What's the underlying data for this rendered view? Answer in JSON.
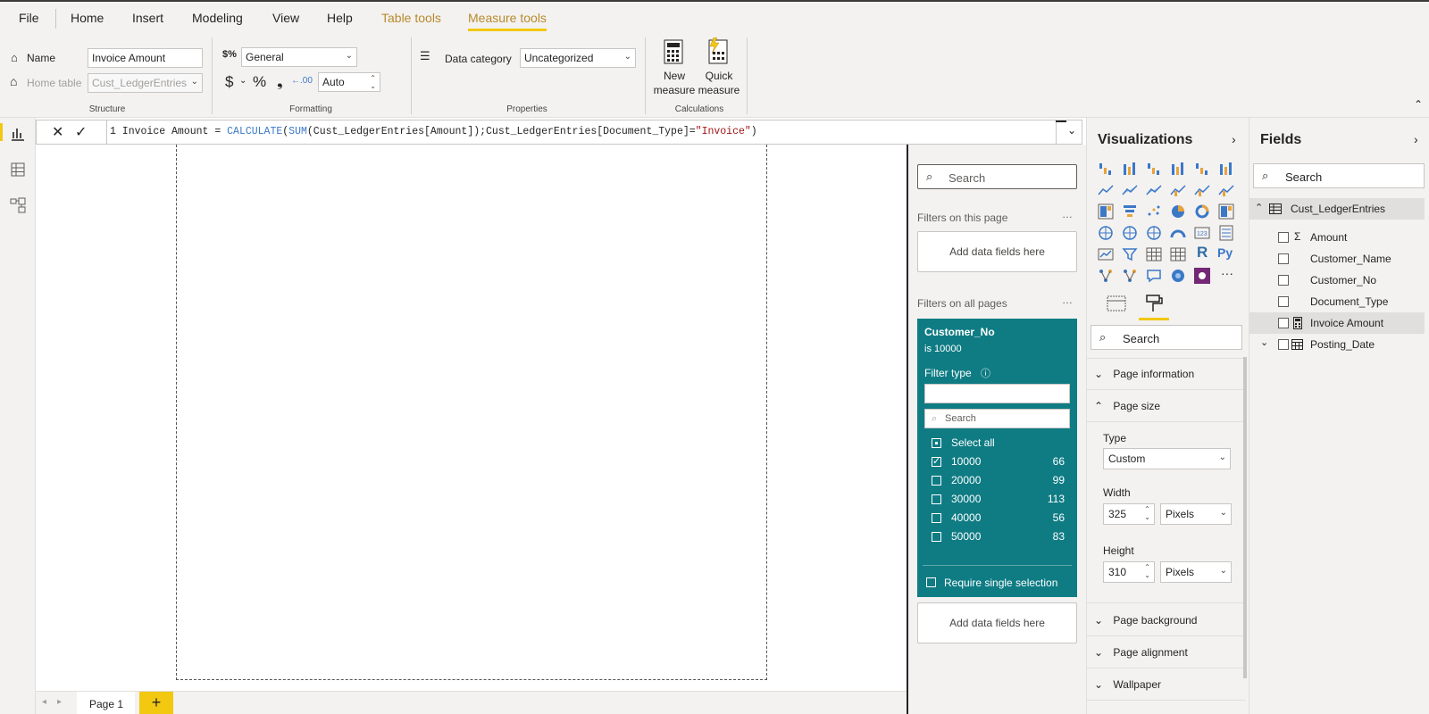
{
  "menu": {
    "file": "File",
    "home": "Home",
    "insert": "Insert",
    "modeling": "Modeling",
    "view": "View",
    "help": "Help",
    "table_tools": "Table tools",
    "measure_tools": "Measure tools"
  },
  "ribbon": {
    "structure": {
      "name_label": "Name",
      "name_value": "Invoice Amount",
      "home_table_label": "Home table",
      "home_table_value": "Cust_LedgerEntries",
      "group_label": "Structure"
    },
    "formatting": {
      "format_value": "General",
      "currency_symbol": "$",
      "percent_symbol": "%",
      "comma_symbol": "❟",
      "decimals_value": "Auto",
      "group_label": "Formatting"
    },
    "properties": {
      "data_category_label": "Data category",
      "data_category_value": "Uncategorized",
      "group_label": "Properties"
    },
    "calculations": {
      "new_measure_line1": "New",
      "new_measure_line2": "measure",
      "quick_measure_line1": "Quick",
      "quick_measure_line2": "measure",
      "group_label": "Calculations"
    }
  },
  "formula": {
    "line_no": "1",
    "part1": " Invoice Amount = ",
    "fn_calculate": "CALCULATE",
    "part2": "(",
    "fn_sum": "SUM",
    "part3": "(Cust_LedgerEntries[Amount]);Cust_LedgerEntries[Document_Type]=",
    "string": "\"Invoice\"",
    "part4": ")"
  },
  "pagetabs": {
    "page1": "Page 1",
    "add": "+"
  },
  "filters": {
    "search_placeholder": "Search",
    "on_this_page": "Filters on this page",
    "add_fields": "Add data fields here",
    "on_all_pages": "Filters on all pages",
    "more": "…",
    "card": {
      "field": "Customer_No",
      "condition": "is 10000",
      "filter_type_label": "Filter type",
      "search_placeholder": "Search",
      "select_all": "Select all",
      "items": [
        {
          "label": "10000",
          "count": "66",
          "checked": true
        },
        {
          "label": "20000",
          "count": "99",
          "checked": false
        },
        {
          "label": "30000",
          "count": "113",
          "checked": false
        },
        {
          "label": "40000",
          "count": "56",
          "checked": false
        },
        {
          "label": "50000",
          "count": "83",
          "checked": false
        }
      ],
      "require_single": "Require single selection"
    },
    "add_fields_bottom": "Add data fields here"
  },
  "visualizations": {
    "title": "Visualizations",
    "search_placeholder": "Search",
    "sections": {
      "page_information": "Page information",
      "page_size": "Page size",
      "type_label": "Type",
      "type_value": "Custom",
      "width_label": "Width",
      "width_value": "325",
      "width_unit": "Pixels",
      "height_label": "Height",
      "height_value": "310",
      "height_unit": "Pixels",
      "page_background": "Page background",
      "page_alignment": "Page alignment",
      "wallpaper": "Wallpaper"
    },
    "r_icon": "R",
    "py_icon": "Py",
    "more_icon": "···"
  },
  "fields": {
    "title": "Fields",
    "search_placeholder": "Search",
    "table_name": "Cust_LedgerEntries",
    "items": [
      {
        "label": "Amount",
        "icon": "sigma-icon",
        "selected": false
      },
      {
        "label": "Customer_Name",
        "icon": "",
        "selected": false
      },
      {
        "label": "Customer_No",
        "icon": "",
        "selected": false
      },
      {
        "label": "Document_Type",
        "icon": "",
        "selected": false
      },
      {
        "label": "Invoice Amount",
        "icon": "calculator-icon",
        "selected": true
      },
      {
        "label": "Posting_Date",
        "icon": "calendar-icon",
        "selected": false
      }
    ]
  },
  "colors": {
    "accent": "#f2c811",
    "filter_card": "#0f7c84",
    "context_tab": "#b88a2b"
  }
}
